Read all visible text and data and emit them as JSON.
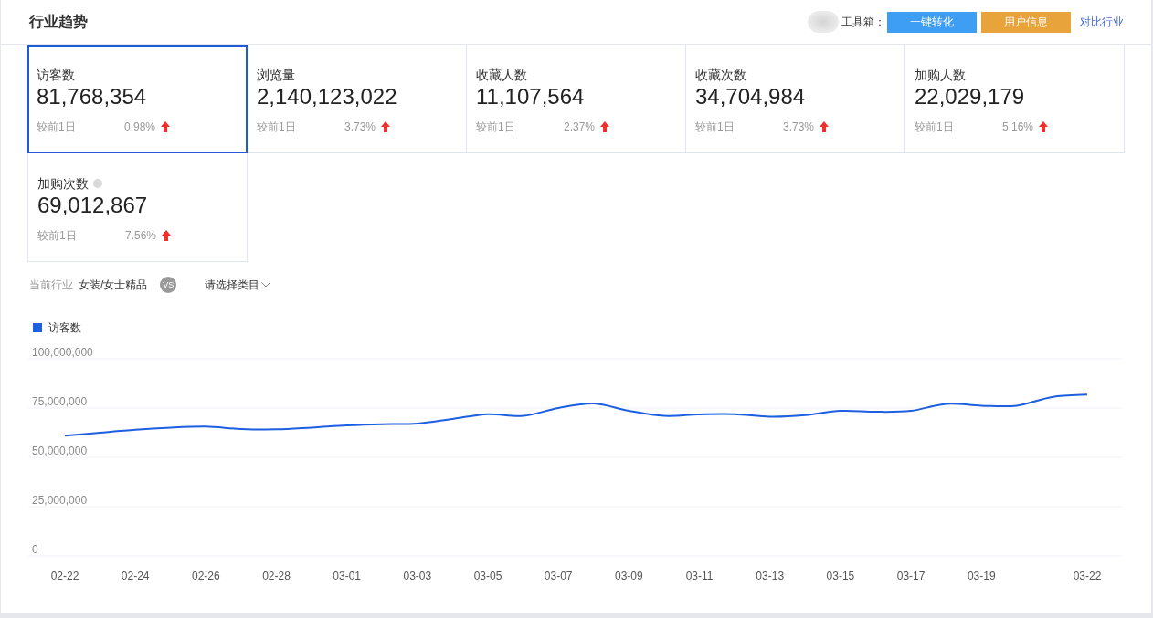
{
  "header": {
    "title": "行业趋势",
    "toolbox_label": "工具箱：",
    "buttons": [
      {
        "label": "一键转化",
        "color": "#3d9ef4"
      },
      {
        "label": "用户信息",
        "color": "#e8a33b"
      }
    ],
    "link": "对比行业"
  },
  "metrics": [
    {
      "label": "访客数",
      "value": "81,768,354",
      "compare_label": "较前1日",
      "change": "0.98%",
      "increase": true,
      "selected": true,
      "help": false
    },
    {
      "label": "浏览量",
      "value": "2,140,123,022",
      "compare_label": "较前1日",
      "change": "3.73%",
      "increase": true,
      "selected": false,
      "help": false
    },
    {
      "label": "收藏人数",
      "value": "11,107,564",
      "compare_label": "较前1日",
      "change": "2.37%",
      "increase": true,
      "selected": false,
      "help": false
    },
    {
      "label": "收藏次数",
      "value": "34,704,984",
      "compare_label": "较前1日",
      "change": "3.73%",
      "increase": true,
      "selected": false,
      "help": false
    },
    {
      "label": "加购人数",
      "value": "22,029,179",
      "compare_label": "较前1日",
      "change": "5.16%",
      "increase": true,
      "selected": false,
      "help": false
    },
    {
      "label": "加购次数",
      "value": "69,012,867",
      "compare_label": "较前1日",
      "change": "7.56%",
      "increase": true,
      "selected": false,
      "help": true
    }
  ],
  "filter": {
    "industry_label": "当前行业",
    "industry": "女装/女士精品",
    "versus": "VS",
    "category_select": "请选择类目"
  },
  "chart": {
    "chart_data": {
      "type": "line",
      "categories": [
        "02-22",
        null,
        "02-24",
        null,
        "02-26",
        null,
        "02-28",
        null,
        "03-01",
        null,
        "03-03",
        null,
        "03-05",
        null,
        "03-07",
        null,
        "03-09",
        null,
        "03-11",
        null,
        "03-13",
        null,
        "03-15",
        null,
        "03-17",
        null,
        "03-19",
        null,
        null,
        "03-22"
      ],
      "ylim": [
        0,
        100000000
      ],
      "yticks": [
        {
          "value": 0,
          "label": "0"
        },
        {
          "value": 25000000,
          "label": "25,000,000"
        },
        {
          "value": 50000000,
          "label": "50,000,000"
        },
        {
          "value": 75000000,
          "label": "75,000,000"
        },
        {
          "value": 100000000,
          "label": "100,000,000"
        }
      ],
      "grid": true,
      "series": [
        {
          "name": "访客数",
          "color": "#1c5fe0",
          "values": [
            61000000,
            62500000,
            64000000,
            65100000,
            65600000,
            64400000,
            64200000,
            65100000,
            66200000,
            66800000,
            67100000,
            69500000,
            71900000,
            71000000,
            75000000,
            77300000,
            73600000,
            71000000,
            71800000,
            71900000,
            70600000,
            71400000,
            73600000,
            73100000,
            73600000,
            77100000,
            76200000,
            76200000,
            80600000,
            81800000
          ]
        }
      ]
    }
  }
}
